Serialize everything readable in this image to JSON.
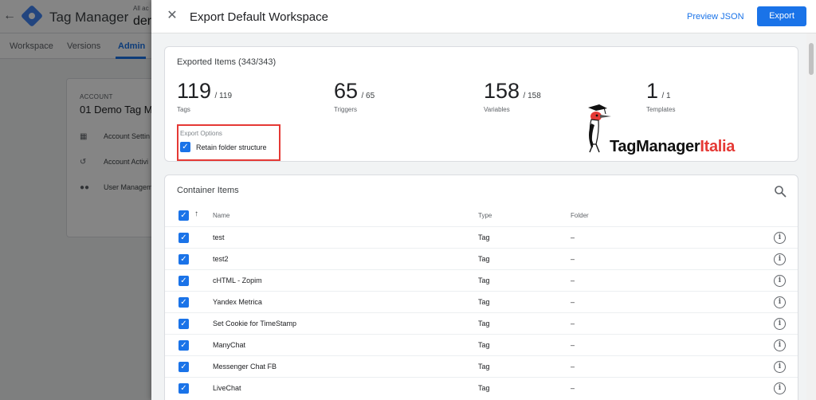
{
  "background": {
    "product_name": "Tag Manager",
    "account_label_small": "All ac",
    "account_name_partial": "der",
    "nav_tabs": [
      "Workspace",
      "Versions",
      "Admin"
    ],
    "active_tab": "Admin",
    "account_card": {
      "label": "ACCOUNT",
      "name": "01 Demo Tag M",
      "items": [
        "Account Settin",
        "Account Activi",
        "User Managem"
      ]
    }
  },
  "panel": {
    "title": "Export Default Workspace",
    "preview_label": "Preview JSON",
    "export_label": "Export"
  },
  "exported": {
    "title": "Exported Items (343/343)",
    "stats": [
      {
        "count": "119",
        "total": "/ 119",
        "label": "Tags"
      },
      {
        "count": "65",
        "total": "/ 65",
        "label": "Triggers"
      },
      {
        "count": "158",
        "total": "/ 158",
        "label": "Variables"
      },
      {
        "count": "1",
        "total": "/ 1",
        "label": "Templates"
      }
    ],
    "options_label": "Export Options",
    "retain_label": "Retain folder structure",
    "retain_checked": true
  },
  "logo": {
    "text_main": "TagManager",
    "text_accent": "Italia"
  },
  "container": {
    "title": "Container Items",
    "columns": {
      "name": "Name",
      "type": "Type",
      "folder": "Folder"
    },
    "rows": [
      {
        "name": "test",
        "type": "Tag",
        "folder": "–"
      },
      {
        "name": "test2",
        "type": "Tag",
        "folder": "–"
      },
      {
        "name": "cHTML - Zopim",
        "type": "Tag",
        "folder": "–"
      },
      {
        "name": "Yandex Metrica",
        "type": "Tag",
        "folder": "–"
      },
      {
        "name": "Set Cookie for TimeStamp",
        "type": "Tag",
        "folder": "–"
      },
      {
        "name": "ManyChat",
        "type": "Tag",
        "folder": "–"
      },
      {
        "name": "Messenger Chat FB",
        "type": "Tag",
        "folder": "–"
      },
      {
        "name": "LiveChat",
        "type": "Tag",
        "folder": "–"
      }
    ]
  },
  "colors": {
    "accent": "#1a73e8",
    "highlight_box": "#e53935",
    "logo_accent": "#e53935"
  },
  "icons": {
    "close": "close-icon",
    "search": "search-icon",
    "info": "info-icon",
    "sort": "arrow-up-icon",
    "checkbox": "checkbox-checked-icon"
  }
}
